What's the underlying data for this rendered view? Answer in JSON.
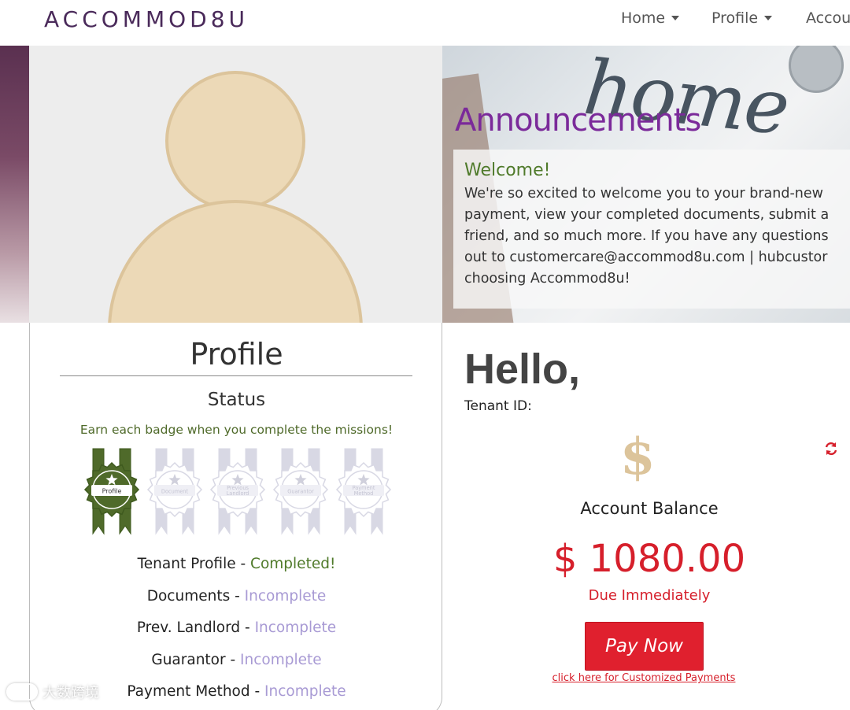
{
  "navbar": {
    "brand": "ACCOMMOD8U",
    "items": [
      {
        "label": "Home"
      },
      {
        "label": "Profile"
      },
      {
        "label": "Accou"
      }
    ]
  },
  "hero": {
    "background_word": "home",
    "announcements_title": "Announcements",
    "welcome_title": "Welcome!",
    "welcome_text": "We're so excited to welcome you to your brand-new\npayment, view your completed documents, submit a\nfriend, and so much more. If you have any questions\nout to customercare@accommod8u.com | hubcustor\nchoosing Accommod8u!"
  },
  "profile": {
    "title": "Profile",
    "status_title": "Status",
    "badge_hint": "Earn each badge when you complete the missions!",
    "badges": [
      {
        "label": "Profile",
        "earned": true
      },
      {
        "label": "Document",
        "earned": false
      },
      {
        "label": "Previous Landlord",
        "earned": false
      },
      {
        "label": "Guarantor",
        "earned": false
      },
      {
        "label": "Payment Method",
        "earned": false
      }
    ],
    "status_items": [
      {
        "label": "Tenant Profile - ",
        "status": "Completed!",
        "complete": true
      },
      {
        "label": "Documents - ",
        "status": "Incomplete",
        "complete": false
      },
      {
        "label": "Prev. Landlord - ",
        "status": "Incomplete",
        "complete": false
      },
      {
        "label": "Guarantor - ",
        "status": "Incomplete",
        "complete": false
      },
      {
        "label": "Payment Method - ",
        "status": "Incomplete",
        "complete": false
      }
    ]
  },
  "account": {
    "greeting": "Hello,",
    "tenant_id_label": "Tenant ID:",
    "currency_icon": "$",
    "balance_label": "Account Balance",
    "balance_amount": "$ 1080.00",
    "due_text": "Due Immediately",
    "pay_button": "Pay Now",
    "custom_link": "click here for Customized Payments"
  },
  "watermark": {
    "text": "大数跨境"
  },
  "colors": {
    "brand_purple": "#4a2a5a",
    "announce_purple": "#7b2a9a",
    "success_green": "#4f7a2a",
    "incomplete_lavender": "#a89ad4",
    "alert_red": "#d61f2b",
    "avatar_tan": "#ecd9b7"
  }
}
